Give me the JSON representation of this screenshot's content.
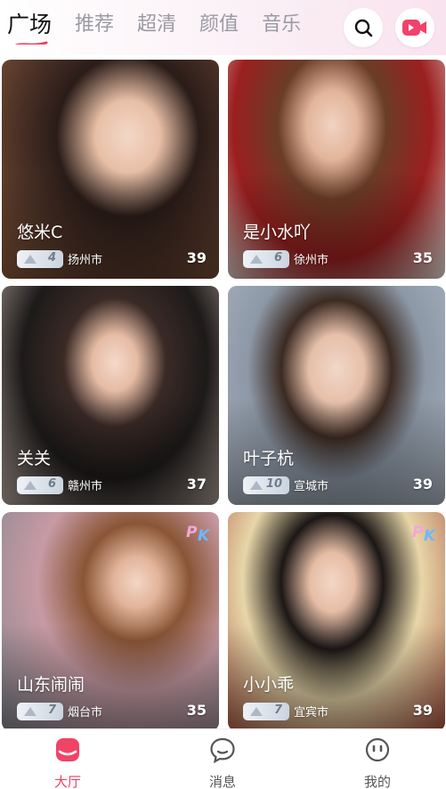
{
  "tabs": [
    "广场",
    "推荐",
    "超清",
    "颜值",
    "音乐"
  ],
  "active_tab": 0,
  "header_icons": {
    "search": "search-icon",
    "live": "video-camera-icon"
  },
  "cards": [
    {
      "name": "悠米C",
      "level": "4",
      "city": "扬州市",
      "age": "39",
      "pk": false
    },
    {
      "name": "是小水吖",
      "level": "6",
      "city": "徐州市",
      "age": "35",
      "pk": false
    },
    {
      "name": "关关",
      "level": "6",
      "city": "赣州市",
      "age": "37",
      "pk": false
    },
    {
      "name": "叶子杭",
      "level": "10",
      "city": "宣城市",
      "age": "39",
      "pk": false
    },
    {
      "name": "山东闹闹",
      "level": "7",
      "city": "烟台市",
      "age": "35",
      "pk": true
    },
    {
      "name": "小小乖",
      "level": "7",
      "city": "宜宾市",
      "age": "39",
      "pk": true
    }
  ],
  "bottom_nav": [
    {
      "label": "大厅",
      "icon": "hall-icon",
      "active": true
    },
    {
      "label": "消息",
      "icon": "message-icon",
      "active": false
    },
    {
      "label": "我的",
      "icon": "profile-icon",
      "active": false
    }
  ],
  "colors": {
    "accent": "#ef3f5f",
    "inactive_tab": "#9a9aa3"
  }
}
